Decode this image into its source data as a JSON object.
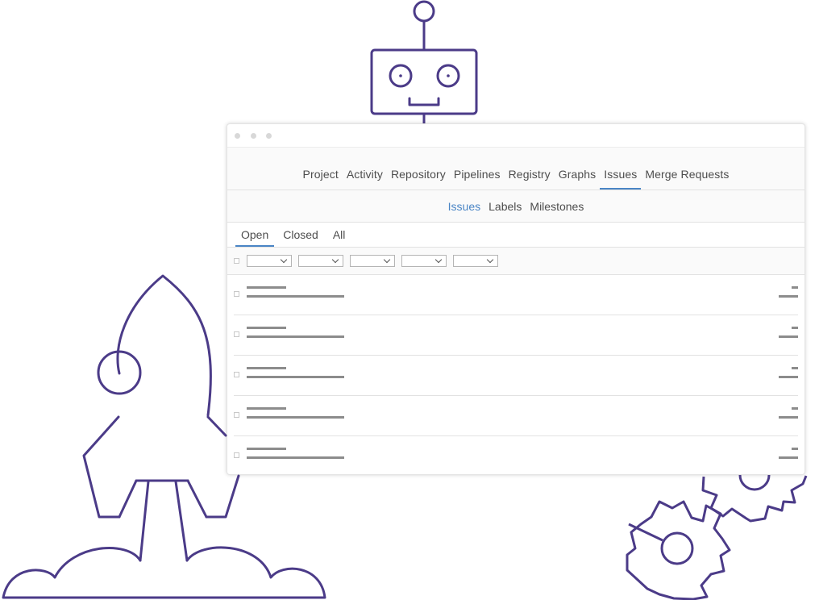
{
  "illustration": {
    "line_color": "#4b3b88",
    "icons": [
      "robot-icon",
      "rocket-icon",
      "cloud-icon",
      "gear-icon"
    ]
  },
  "window": {
    "controls": [
      "close-dot",
      "minimize-dot",
      "maximize-dot"
    ]
  },
  "main_nav": {
    "items": [
      {
        "label": "Project",
        "active": false
      },
      {
        "label": "Activity",
        "active": false
      },
      {
        "label": "Repository",
        "active": false
      },
      {
        "label": "Pipelines",
        "active": false
      },
      {
        "label": "Registry",
        "active": false
      },
      {
        "label": "Graphs",
        "active": false
      },
      {
        "label": "Issues",
        "active": true
      },
      {
        "label": "Merge Requests",
        "active": false
      }
    ]
  },
  "sub_nav": {
    "items": [
      {
        "label": "Issues",
        "active": true
      },
      {
        "label": "Labels",
        "active": false
      },
      {
        "label": "Milestones",
        "active": false
      }
    ]
  },
  "state_tabs": {
    "items": [
      {
        "label": "Open",
        "active": true
      },
      {
        "label": "Closed",
        "active": false
      },
      {
        "label": "All",
        "active": false
      }
    ]
  },
  "filters": {
    "dropdown_count": 5
  },
  "issues": {
    "row_count": 5
  },
  "colors": {
    "accent": "#4a85c5",
    "text": "#4d4d4d",
    "placeholder_bar": "#8c8c8c"
  }
}
